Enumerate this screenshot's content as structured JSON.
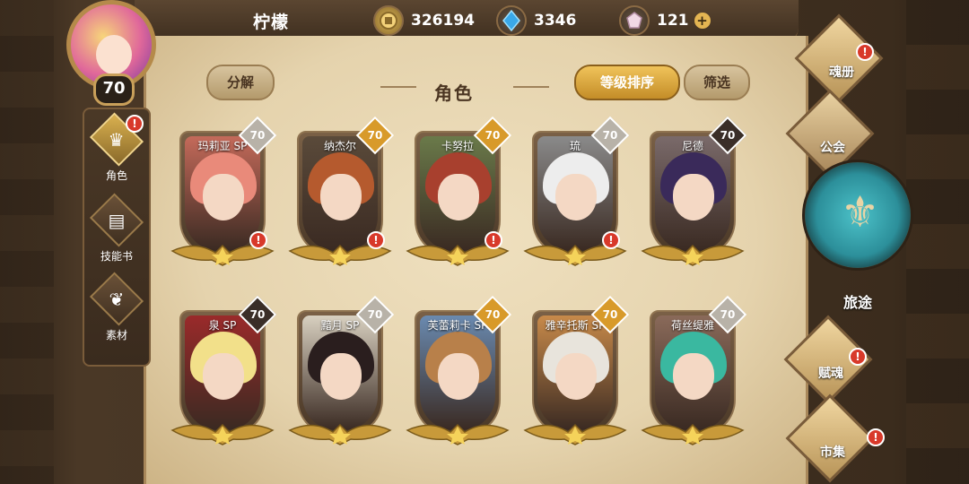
{
  "player": {
    "name": "柠檬",
    "level": "70"
  },
  "currencies": [
    {
      "name": "gold-coin",
      "value": "326194",
      "icon": "coin-icon"
    },
    {
      "name": "crystal",
      "value": "3346",
      "icon": "blue-crystal-icon"
    },
    {
      "name": "gem",
      "value": "121",
      "icon": "pink-gem-icon",
      "has_plus": true
    }
  ],
  "plus": "+",
  "alert_mark": "!",
  "buttons": {
    "decompose": "分解",
    "sort_by_level": "等级排序",
    "filter": "筛选"
  },
  "section_title": "角色",
  "left_nav": [
    {
      "label": "角色",
      "icon": "helmet-icon",
      "active": true,
      "alert": true
    },
    {
      "label": "技能书",
      "icon": "book-icon",
      "active": false,
      "alert": false
    },
    {
      "label": "素材",
      "icon": "material-icon",
      "active": false,
      "alert": false
    }
  ],
  "right_nav": {
    "soul_book": "魂册",
    "guild": "公会",
    "journey": "旅途",
    "endow_soul": "赋魂",
    "market": "市集"
  },
  "cards": [
    {
      "name": "玛莉亚 SP",
      "level": "70",
      "rarity": "silver",
      "alert": true,
      "hair": "#e98a7a",
      "bg": "#c46a5a"
    },
    {
      "name": "纳杰尔",
      "level": "70",
      "rarity": "gold",
      "alert": true,
      "hair": "#b55a2e",
      "bg": "#5a4a3a"
    },
    {
      "name": "卡努拉",
      "level": "70",
      "rarity": "gold",
      "alert": true,
      "hair": "#a8402e",
      "bg": "#6a7a4a"
    },
    {
      "name": "琉",
      "level": "70",
      "rarity": "silver",
      "alert": true,
      "hair": "#ededed",
      "bg": "#8a8a8a"
    },
    {
      "name": "尼德",
      "level": "70",
      "rarity": "dark",
      "alert": false,
      "hair": "#3a2a5a",
      "bg": "#7a6a6a"
    },
    {
      "name": "泉 SP",
      "level": "70",
      "rarity": "dark",
      "alert": false,
      "hair": "#f2e08a",
      "bg": "#9a2a2a"
    },
    {
      "name": "黯月 SP",
      "level": "70",
      "rarity": "silver",
      "alert": false,
      "hair": "#2a1e1e",
      "bg": "#d8d0c0"
    },
    {
      "name": "芙蕾莉卡 SP",
      "level": "70",
      "rarity": "gold",
      "alert": false,
      "hair": "#b8804a",
      "bg": "#6a8ab0"
    },
    {
      "name": "雅辛托斯 SP",
      "level": "70",
      "rarity": "gold",
      "alert": false,
      "hair": "#e8e4dc",
      "bg": "#c88a4a"
    },
    {
      "name": "荷丝缇雅",
      "level": "70",
      "rarity": "silver",
      "alert": false,
      "hair": "#3ab8a0",
      "bg": "#8a6a5a"
    }
  ]
}
